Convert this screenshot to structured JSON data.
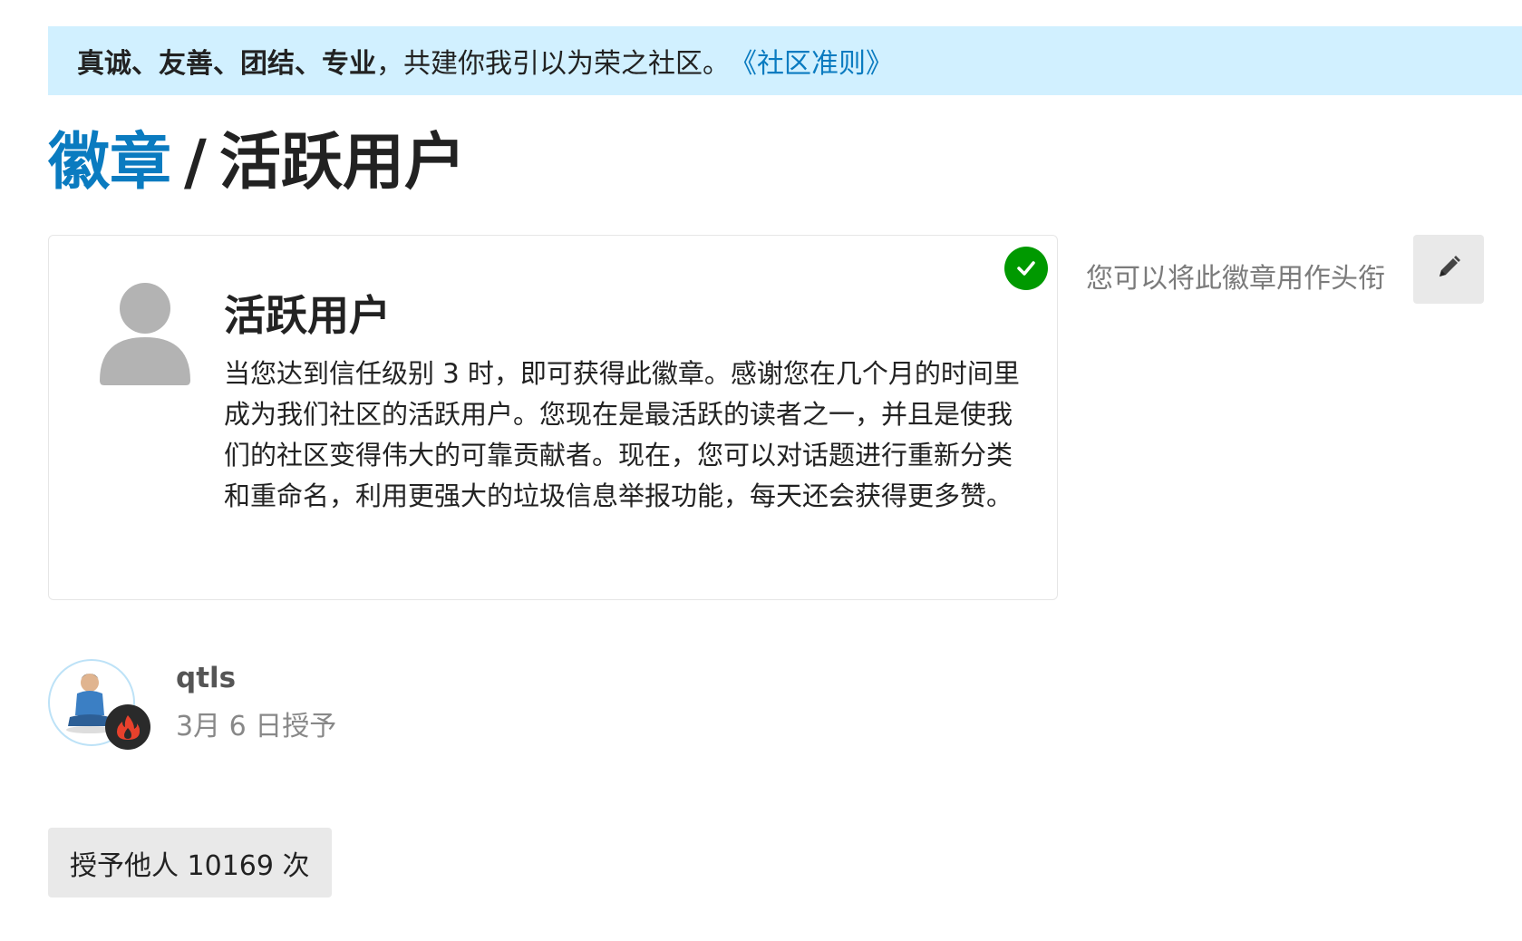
{
  "banner": {
    "bold_text": "真诚、友善、团结、专业",
    "normal_text": "，共建你我引以为荣之社区。",
    "link_text": "《社区准则》"
  },
  "title": {
    "crumb": "徽章",
    "separator": "/",
    "current": "活跃用户"
  },
  "badge": {
    "name": "活跃用户",
    "description": "当您达到信任级别 3 时，即可获得此徽章。感谢您在几个月的时间里成为我们社区的活跃用户。您现在是最活跃的读者之一，并且是使我们的社区变得伟大的可靠贡献者。现在，您可以对话题进行重新分类和重命名，利用更强大的垃圾信息举报功能，每天还会获得更多赞。",
    "icon": "user-icon",
    "earned": true
  },
  "title_hint": "您可以将此徽章用作头衔",
  "grantee": {
    "username": "qtls",
    "granted_date": "3月 6 日授予",
    "flair_icon": "fire-icon"
  },
  "granted_count_label": "授予他人 10169 次",
  "colors": {
    "banner_bg": "#d1f0ff",
    "link": "#0a7bc0",
    "check": "#009900",
    "button_bg": "#e9e9e9"
  }
}
